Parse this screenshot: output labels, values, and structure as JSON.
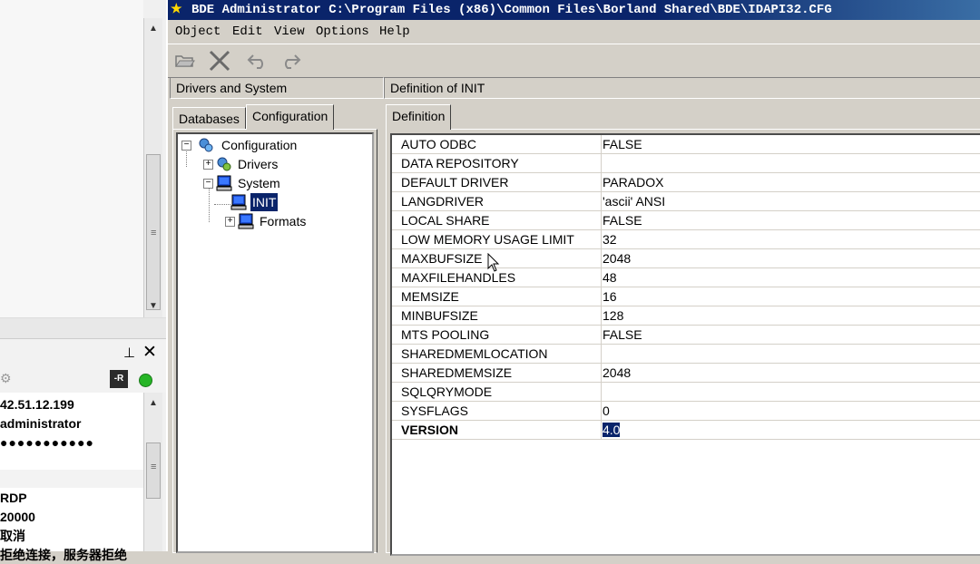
{
  "left_panel": {
    "rows": [
      "42.51.12.199",
      "administrator",
      "●●●●●●●●●●●",
      "",
      "RDP",
      "20000",
      "取消",
      "拒绝连接，服务器拒绝"
    ],
    "rdp_badge": "-R",
    "status_color": "#26b526"
  },
  "window": {
    "title": "BDE Administrator  C:\\Program Files (x86)\\Common Files\\Borland Shared\\BDE\\IDAPI32.CFG",
    "menu": [
      "Object",
      "Edit",
      "View",
      "Options",
      "Help"
    ],
    "toolbar_icons": [
      "open-folder-icon",
      "delete-x-icon",
      "undo-icon",
      "redo-icon"
    ]
  },
  "left_header": "Drivers and System",
  "right_header": "Definition of INIT",
  "tabs": {
    "databases": "Databases",
    "configuration": "Configuration",
    "definition": "Definition"
  },
  "tree": {
    "root": "Configuration",
    "drivers": "Drivers",
    "system": "System",
    "init": "INIT",
    "formats": "Formats"
  },
  "definition": {
    "rows": [
      {
        "name": "AUTO ODBC",
        "value": "FALSE"
      },
      {
        "name": "DATA REPOSITORY",
        "value": ""
      },
      {
        "name": "DEFAULT DRIVER",
        "value": "PARADOX"
      },
      {
        "name": "LANGDRIVER",
        "value": "'ascii' ANSI"
      },
      {
        "name": "LOCAL SHARE",
        "value": "FALSE"
      },
      {
        "name": "LOW MEMORY USAGE LIMIT",
        "value": "32"
      },
      {
        "name": "MAXBUFSIZE",
        "value": "2048"
      },
      {
        "name": "MAXFILEHANDLES",
        "value": "48"
      },
      {
        "name": "MEMSIZE",
        "value": "16"
      },
      {
        "name": "MINBUFSIZE",
        "value": "128"
      },
      {
        "name": "MTS POOLING",
        "value": "FALSE"
      },
      {
        "name": "SHAREDMEMLOCATION",
        "value": ""
      },
      {
        "name": "SHAREDMEMSIZE",
        "value": "2048"
      },
      {
        "name": "SQLQRYMODE",
        "value": ""
      },
      {
        "name": "SYSFLAGS",
        "value": "0"
      },
      {
        "name": "VERSION",
        "value": "4.0"
      }
    ]
  },
  "colors": {
    "title_bar": "#0a246a",
    "selection": "#0a246a",
    "face": "#d4d0c8"
  }
}
